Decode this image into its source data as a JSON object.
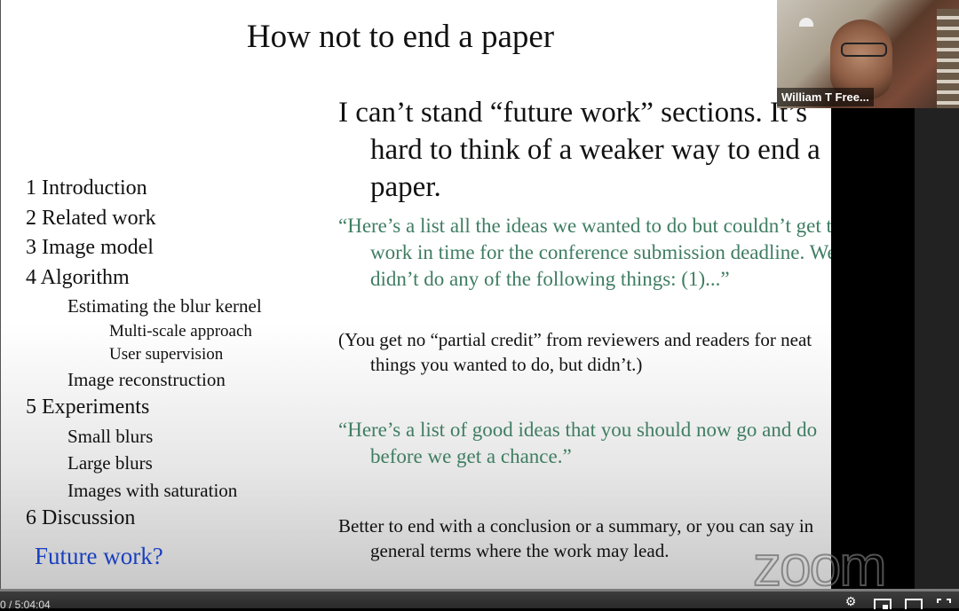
{
  "slide": {
    "title": "How not to end a paper",
    "toc": [
      {
        "level": 1,
        "text": "1 Introduction"
      },
      {
        "level": 1,
        "text": "2 Related work"
      },
      {
        "level": 1,
        "text": "3 Image model"
      },
      {
        "level": 1,
        "text": "4 Algorithm"
      },
      {
        "level": 2,
        "text": "Estimating the blur kernel"
      },
      {
        "level": 3,
        "text": "Multi-scale approach"
      },
      {
        "level": 3,
        "text": "User supervision"
      },
      {
        "level": 2,
        "text": "Image reconstruction"
      },
      {
        "level": 1,
        "text": "5 Experiments"
      },
      {
        "level": 2,
        "text": "Small blurs"
      },
      {
        "level": 2,
        "text": "Large blurs"
      },
      {
        "level": 2,
        "text": "Images with saturation"
      },
      {
        "level": 1,
        "text": "6 Discussion"
      }
    ],
    "future_work": "Future work?",
    "main_statement": "I can’t stand “future work” sections. It’s hard to think of a weaker way to end a paper.",
    "quote1": "“Here’s a list all the ideas we wanted to do but couldn’t get to work in time for the conference submission deadline.  We didn’t do any of the following things:  (1)...”",
    "note": "(You get no “partial credit” from reviewers and readers for neat things you wanted to do, but didn’t.)",
    "quote2": "“Here’s a list of good ideas that you should now go and do before we get a chance.”",
    "conclusion": "Better to end with a conclusion or a summary, or you can say in general terms where the work may lead.",
    "colors": {
      "quote": "#3f7d62",
      "future_work": "#1a3fbf"
    }
  },
  "participant": {
    "name": "William T Free..."
  },
  "watermark": "zoom",
  "player": {
    "time": "0 / 5:04:04",
    "progress_fraction": 0,
    "controls": [
      {
        "icon": "settings-icon"
      },
      {
        "icon": "miniplayer-icon"
      },
      {
        "icon": "theater-mode-icon"
      },
      {
        "icon": "fullscreen-icon"
      }
    ]
  }
}
